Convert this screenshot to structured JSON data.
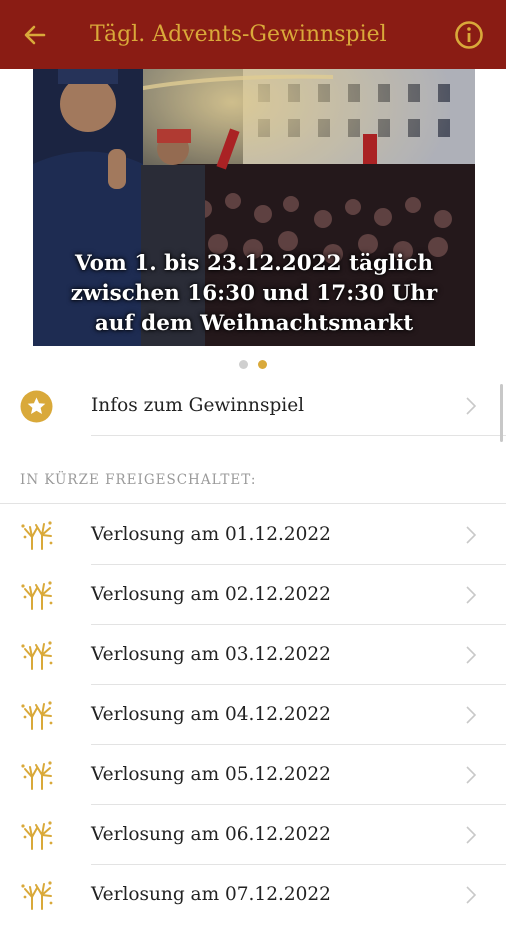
{
  "header": {
    "title": "Tägl. Advents-Gewinnspiel",
    "back_icon": "arrow-left-icon",
    "info_icon": "info-circle-icon",
    "background_color": "#8a1c14",
    "accent_color": "#d9a93a"
  },
  "slider": {
    "caption_lines": [
      "Vom 1. bis 23.12.2022 täglich",
      "zwischen 16:30 und 17:30 Uhr",
      "auf dem Weihnachtsmarkt"
    ],
    "slide_count": 2,
    "active_index": 1
  },
  "info_row": {
    "label": "Infos zum Gewinnspiel",
    "icon": "star-badge-icon"
  },
  "section_title": "IN KÜRZE FREIGESCHALTET:",
  "draws": [
    {
      "label": "Verlosung am 01.12.2022",
      "icon": "fireworks-icon"
    },
    {
      "label": "Verlosung am 02.12.2022",
      "icon": "fireworks-icon"
    },
    {
      "label": "Verlosung am 03.12.2022",
      "icon": "fireworks-icon"
    },
    {
      "label": "Verlosung am 04.12.2022",
      "icon": "fireworks-icon"
    },
    {
      "label": "Verlosung am 05.12.2022",
      "icon": "fireworks-icon"
    },
    {
      "label": "Verlosung am 06.12.2022",
      "icon": "fireworks-icon"
    },
    {
      "label": "Verlosung am 07.12.2022",
      "icon": "fireworks-icon"
    }
  ]
}
